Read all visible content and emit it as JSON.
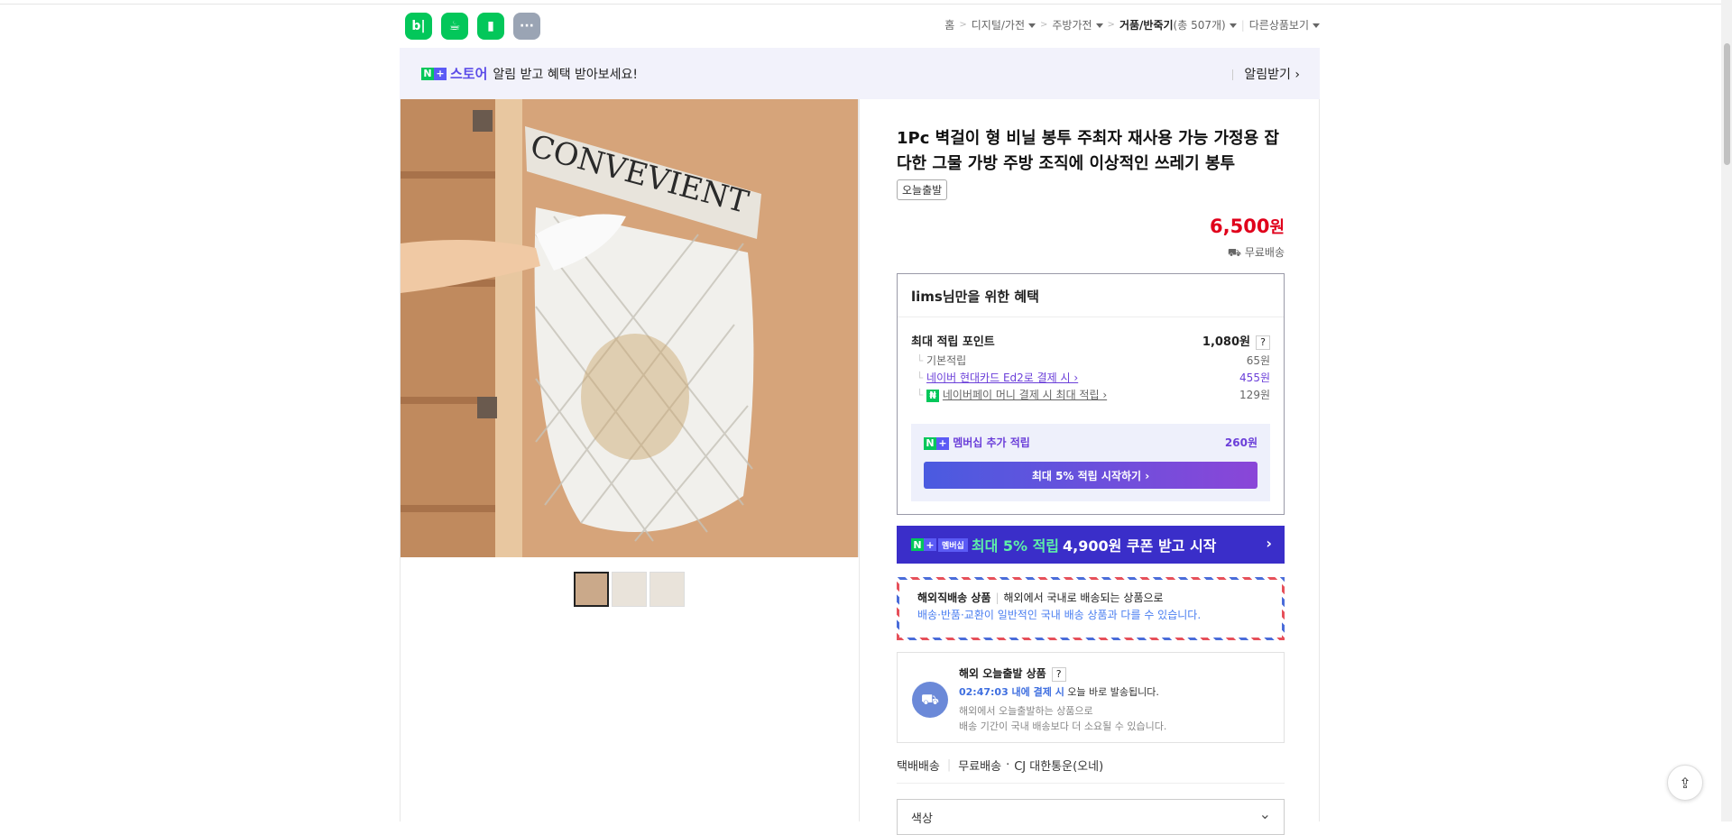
{
  "header": {
    "icons": [
      "blog-icon",
      "cafe-icon",
      "bookmark-icon",
      "more-icon"
    ],
    "icon_glyphs": [
      "b|",
      "☕",
      "▮",
      "···"
    ],
    "breadcrumb": {
      "home": "홈",
      "level1": "디지털/가전",
      "level2": "주방가전",
      "level3": "거품/반죽기",
      "count": "(총 507개)",
      "more": "다른상품보기"
    }
  },
  "banner": {
    "store_name": "스토어",
    "message": "알림 받고 혜택 받아보세요!",
    "alarm_label": "알림받기 ›"
  },
  "product": {
    "title": "1Pc 벽걸이 형 비닐 봉투 주최자 재사용 가능 가정용 잡다한 그물 가방 주방 조직에 이상적인 쓰레기 봉투",
    "tag": "오늘출발",
    "price": "6,500",
    "price_unit": "원",
    "shipping": "무료배송",
    "image_text": "CONVEVIENT"
  },
  "benefit": {
    "heading": "lims님만을 위한 혜택",
    "max_points_label": "최대 적립 포인트",
    "max_points_value": "1,080원",
    "question": "?",
    "rows": [
      {
        "label": "기본적립",
        "value": "65원"
      },
      {
        "label": "네이버 현대카드 Ed2로 결제 시 ›",
        "value": "455원"
      },
      {
        "label": "네이버페이 머니 결제 시 최대 적립 ›",
        "value": "129원"
      }
    ],
    "membership_label": "멤버십 추가 적립",
    "membership_value": "260원",
    "membership_button": "최대 5% 적립 시작하기 ›"
  },
  "promo": {
    "badge": "멤버십",
    "highlight": "최대 5% 적립",
    "text": "4,900원 쿠폰 받고 시작",
    "chevron": "›"
  },
  "overseas": {
    "title": "해외직배송 상품",
    "text1": "해외에서 국내로 배송되는 상품으로",
    "text2": "배송·반품·교환이 일반적인 국내 배송 상품과 다를 수 있습니다."
  },
  "dispatch": {
    "title": "해외 오늘출발 상품",
    "question": "?",
    "time": "02:47:03 내에 결제 시",
    "time_suffix": " 오늘 바로 발송됩니다.",
    "note1": "해외에서 오늘출발하는 상품으로",
    "note2": "배송 기간이 국내 배송보다 더 소요될 수 있습니다."
  },
  "delivery": {
    "method": "택배배송",
    "fee": "무료배송",
    "carrier": "CJ 대한통운(오네)"
  },
  "option": {
    "label": "색상",
    "chevron": "⌄"
  },
  "share_icon": "⇪",
  "colors": {
    "naver_green": "#03c75a",
    "price_red": "#e0001b",
    "membership_purple": "#6b3fd9",
    "promo_blue": "#3a2ec9"
  }
}
